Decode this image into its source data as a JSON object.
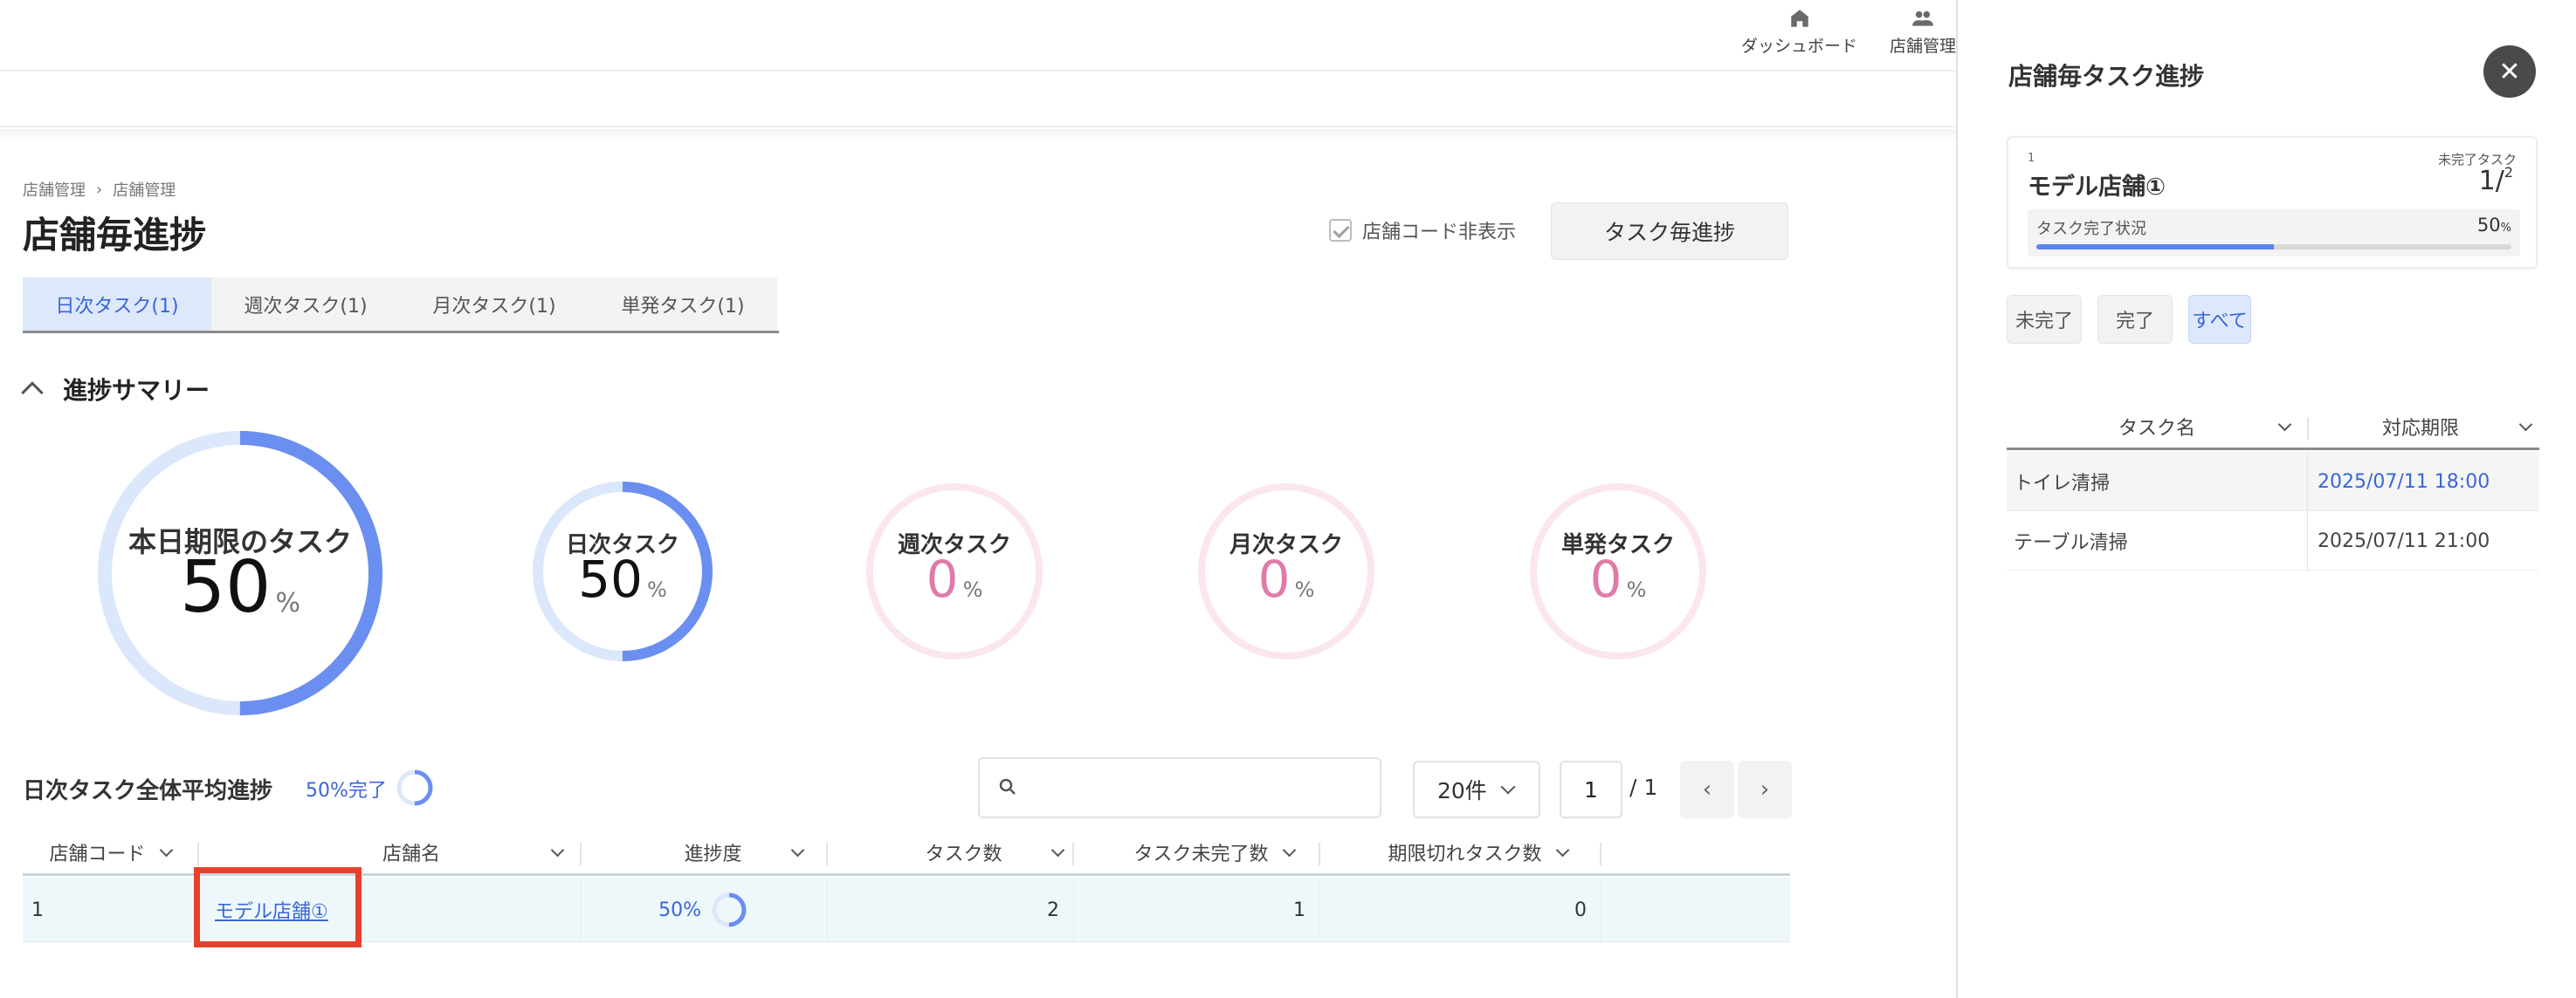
{
  "header": {
    "nav": [
      {
        "label": "ダッシュボード",
        "icon": "home-icon"
      },
      {
        "label": "店舗管理",
        "icon": "people-icon"
      }
    ]
  },
  "breadcrumb": [
    "店舗管理",
    "店舗管理"
  ],
  "page_title": "店舗毎進捗",
  "hide_code": {
    "label": "店舗コード非表示",
    "checked": true
  },
  "task_progress_button": "タスク毎進捗",
  "tabs": [
    {
      "label": "日次タスク(1)",
      "active": true
    },
    {
      "label": "週次タスク(1)",
      "active": false
    },
    {
      "label": "月次タスク(1)",
      "active": false
    },
    {
      "label": "単発タスク(1)",
      "active": false
    }
  ],
  "summary": {
    "title": "進捗サマリー",
    "rings": [
      {
        "label": "本日期限のタスク",
        "value": "50",
        "unit": "%",
        "progress": 0.5,
        "color": "#6b8ff0",
        "track": "#dbe8fb",
        "value_color": "#111111"
      },
      {
        "label": "日次タスク",
        "value": "50",
        "unit": "%",
        "progress": 0.5,
        "color": "#6b8ff0",
        "track": "#dbe8fb",
        "value_color": "#111111"
      },
      {
        "label": "週次タスク",
        "value": "0",
        "unit": "%",
        "progress": 0,
        "color": "#e07aa8",
        "track": "#fbe6ee",
        "value_color": "#e07aa8"
      },
      {
        "label": "月次タスク",
        "value": "0",
        "unit": "%",
        "progress": 0,
        "color": "#e07aa8",
        "track": "#fbe6ee",
        "value_color": "#e07aa8"
      },
      {
        "label": "単発タスク",
        "value": "0",
        "unit": "%",
        "progress": 0,
        "color": "#e07aa8",
        "track": "#fbe6ee",
        "value_color": "#e07aa8"
      }
    ]
  },
  "average": {
    "title": "日次タスク全体平均進捗",
    "text": "50%完了",
    "progress": 0.5
  },
  "search": {
    "placeholder": "",
    "value": ""
  },
  "pagination": {
    "per_page": "20件",
    "page": "1",
    "total": "/ 1",
    "prev": "‹",
    "next": "›"
  },
  "table": {
    "columns": [
      "店舗コード",
      "店舗名",
      "進捗度",
      "タスク数",
      "タスク未完了数",
      "期限切れタスク数"
    ],
    "rows": [
      {
        "code": "1",
        "name": "モデル店舗①",
        "progress": "50%",
        "progress_value": 0.5,
        "tasks": "2",
        "incomplete": "1",
        "overdue": "0"
      }
    ]
  },
  "drawer": {
    "title": "店舗毎タスク進捗",
    "close": "✕",
    "store": {
      "code": "1",
      "name": "モデル店舗①",
      "incomplete_label": "未完了タスク",
      "incomplete": "1",
      "total": "2",
      "status_label": "タスク完了状況",
      "status_value": "50",
      "status_unit": "%",
      "status_progress": 0.5
    },
    "filters": [
      {
        "label": "未完了",
        "active": false
      },
      {
        "label": "完了",
        "active": false
      },
      {
        "label": "すべて",
        "active": true
      }
    ],
    "task_columns": [
      "タスク名",
      "対応期限"
    ],
    "tasks": [
      {
        "name": "トイレ清掃",
        "deadline": "2025/07/11 18:00",
        "deadline_color": "#3a66d6"
      },
      {
        "name": "テーブル清掃",
        "deadline": "2025/07/11 21:00",
        "deadline_color": "#444444"
      }
    ]
  }
}
